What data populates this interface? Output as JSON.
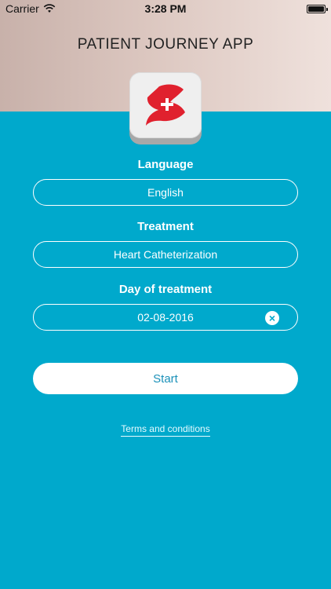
{
  "status_bar": {
    "carrier": "Carrier",
    "time": "3:28 PM"
  },
  "header": {
    "title": "PATIENT JOURNEY APP"
  },
  "form": {
    "language": {
      "label": "Language",
      "value": "English"
    },
    "treatment": {
      "label": "Treatment",
      "value": "Heart Catheterization"
    },
    "day": {
      "label": "Day of treatment",
      "value": "02-08-2016",
      "clear_icon": "×"
    }
  },
  "actions": {
    "start_label": "Start",
    "terms_label": "Terms and conditions"
  },
  "colors": {
    "background": "#00a9cc",
    "header_bg": "#dcc7c0",
    "logo_red": "#e0212e",
    "button_text": "#1b91b9"
  },
  "icons": {
    "wifi": "wifi-icon",
    "battery": "battery-icon",
    "logo": "app-logo-icon",
    "clear": "clear-icon"
  }
}
